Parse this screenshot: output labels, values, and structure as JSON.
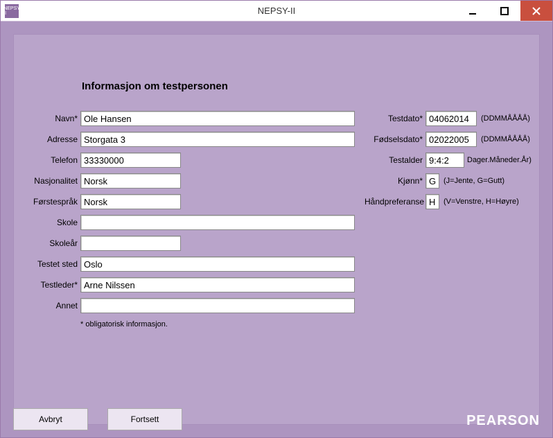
{
  "window": {
    "title": "NEPSY-II",
    "app_icon_text": "NEPSY II"
  },
  "heading": "Informasjon om testpersonen",
  "left": {
    "navn": {
      "label": "Navn",
      "req": "*",
      "value": "Ole Hansen"
    },
    "adresse": {
      "label": "Adresse",
      "value": "Storgata 3"
    },
    "telefon": {
      "label": "Telefon",
      "value": "33330000"
    },
    "nasjonalitet": {
      "label": "Nasjonalitet",
      "value": "Norsk"
    },
    "forstesprak": {
      "label": "Førstespråk",
      "value": "Norsk"
    },
    "skole": {
      "label": "Skole",
      "value": ""
    },
    "skolear": {
      "label": "Skoleår",
      "value": ""
    },
    "testetsted": {
      "label": "Testet sted",
      "value": "Oslo"
    },
    "testleder": {
      "label": "Testleder",
      "req": "*",
      "value": "Arne Nilssen"
    },
    "annet": {
      "label": "Annet",
      "value": ""
    }
  },
  "right": {
    "testdato": {
      "label": "Testdato",
      "req": "*",
      "value": "04062014",
      "hint": "(DDMMÅÅÅÅ)"
    },
    "fodselsdato": {
      "label": "Fødselsdato",
      "req": "*",
      "value": "02022005",
      "hint": "(DDMMÅÅÅÅ)"
    },
    "testalder": {
      "label": "Testalder",
      "value": "9:4:2",
      "hint": "Dager.Måneder.År)"
    },
    "kjonn": {
      "label": "Kjønn",
      "req": "*",
      "value": "G",
      "hint": "(J=Jente, G=Gutt)"
    },
    "handpref": {
      "label": "Håndpreferanse",
      "value": "H",
      "hint": "(V=Venstre, H=Høyre)"
    }
  },
  "note": "* obligatorisk informasjon.",
  "buttons": {
    "cancel": "Avbryt",
    "continue": "Fortsett"
  },
  "brand": "PEARSON"
}
